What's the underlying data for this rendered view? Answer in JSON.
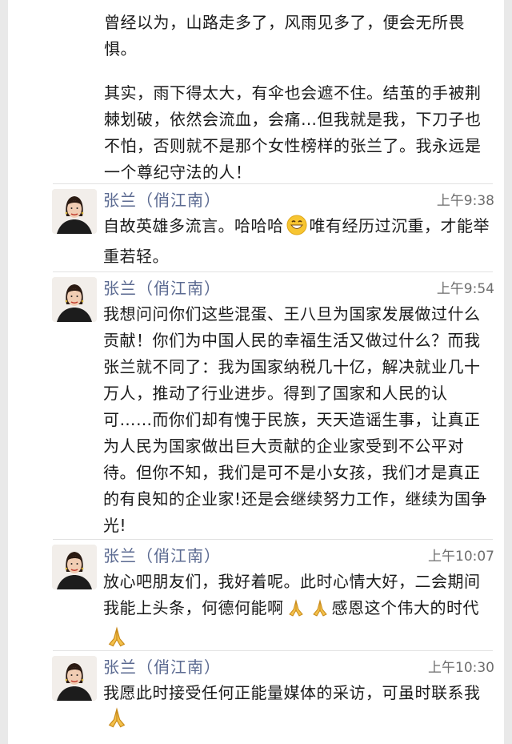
{
  "continued": {
    "para1": "曾经以为，山路走多了，风雨见多了，便会无所畏惧。",
    "para2": "其实，雨下得太大，有伞也会遮不住。结茧的手被荆棘划破，依然会流血，会痛…但我就是我，下刀子也不怕，否则就不是那个女性榜样的张兰了。我永远是一个尊纪守法的人！"
  },
  "messages": [
    {
      "name": "张兰（俏江南）",
      "time": "上午9:38",
      "text_a": "自故英雄多流言。哈哈哈",
      "text_b": "唯有经历过沉重，才能举重若轻。"
    },
    {
      "name": "张兰（俏江南）",
      "time": "上午9:54",
      "text": "我想问问你们这些混蛋、王八旦为国家发展做过什么贡献！你们为中国人民的幸福生活又做过什么？而我张兰就不同了：我为国家纳税几十亿，解决就业几十万人，推动了行业进步。得到了国家和人民的认可……而你们却有愧于民族，天天造谣生事，让真正为人民为国家做出巨大贡献的企业家受到不公平对待。但你不知，我们是可不是小女孩，我们才是真正的有良知的企业家!还是会继续努力工作，继续为国争光!"
    },
    {
      "name": "张兰（俏江南）",
      "time": "上午10:07",
      "text_a": "放心吧朋友们，我好着呢。此时心情大好，二会期间我能上头条，何德何能啊",
      "text_b": "感恩这个伟大的时代"
    },
    {
      "name": "张兰（俏江南）",
      "time": "上午10:30",
      "text_a": "我愿此时接受任何正能量媒体的采访，可虽时联系我"
    }
  ],
  "icons": {
    "laugh": "grinning-face-emoji",
    "pray": "folded-hands-emoji"
  },
  "colors": {
    "name": "#5b6a91",
    "time": "#6e6e6e",
    "text": "#1a1a1a"
  }
}
